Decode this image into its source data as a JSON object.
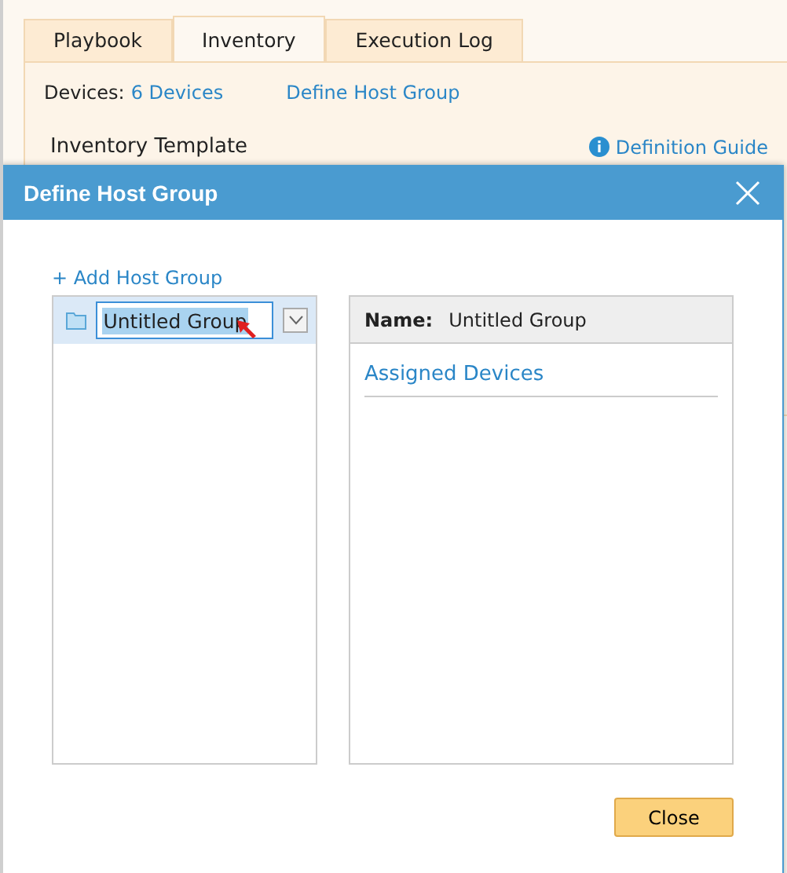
{
  "tabs": [
    {
      "label": "Playbook",
      "selected": false
    },
    {
      "label": "Inventory",
      "selected": true
    },
    {
      "label": "Execution Log",
      "selected": false
    }
  ],
  "devices": {
    "label": "Devices:",
    "link": "6 Devices"
  },
  "define_link": "Define Host Group",
  "section_title": "Inventory Template",
  "guide_link": "Definition Guide",
  "dialog": {
    "title": "Define Host Group",
    "add_link": "+ Add Host Group",
    "groups": [
      {
        "value": "Untitled Group",
        "selected": true
      }
    ],
    "details": {
      "name_label": "Name:",
      "name_value": "Untitled Group",
      "assigned_link": "Assigned Devices"
    },
    "close_button": "Close"
  }
}
